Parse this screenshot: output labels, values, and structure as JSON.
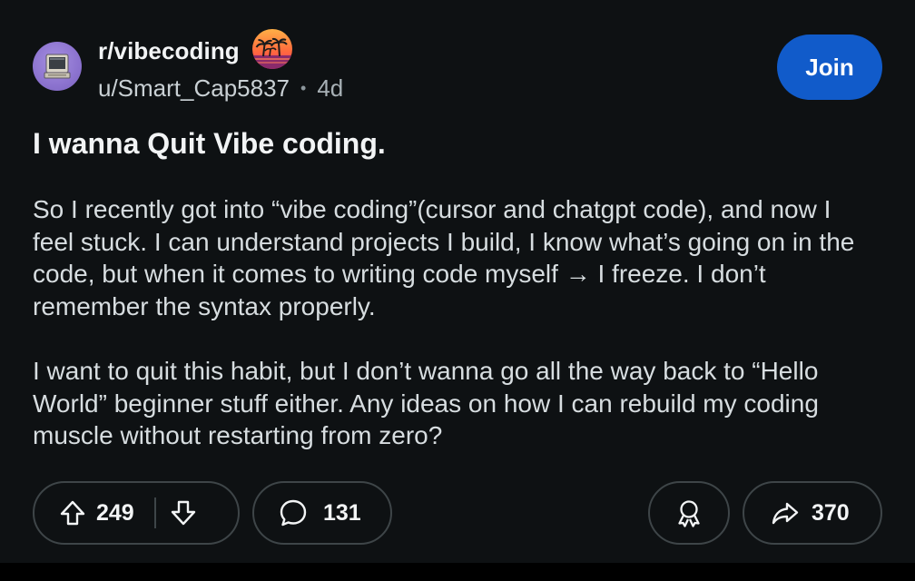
{
  "header": {
    "subreddit": "r/vibecoding",
    "author": "u/Smart_Cap5837",
    "separator": "•",
    "age": "4d",
    "join_label": "Join"
  },
  "post": {
    "title": "I wanna Quit Vibe coding.",
    "paragraphs": [
      "So I recently got into “vibe coding”(cursor and chatgpt code), and now I feel stuck. I can understand projects I build, I know what’s going on in the code, but when it comes to writing code myself → I freeze. I don’t remember the syntax properly.",
      "I want to quit this habit, but I don’t wanna go all the way back to “Hello World” beginner stuff either. Any ideas on how I can rebuild my coding muscle without restarting from zero?"
    ]
  },
  "actions": {
    "upvotes": "249",
    "comments": "131",
    "shares": "370"
  },
  "icons": {
    "avatar": "retro-computer-avatar",
    "badge": "sunset-palm-icon",
    "upvote": "arrow-up-icon",
    "downvote": "arrow-down-icon",
    "comment": "speech-bubble-icon",
    "award": "award-ribbon-icon",
    "share": "share-arrow-icon"
  },
  "colors": {
    "background": "#0e1113",
    "join_button": "#115bca",
    "text": "#f2f4f5",
    "muted": "#a8b1b6",
    "pill_border": "#3e4548"
  }
}
